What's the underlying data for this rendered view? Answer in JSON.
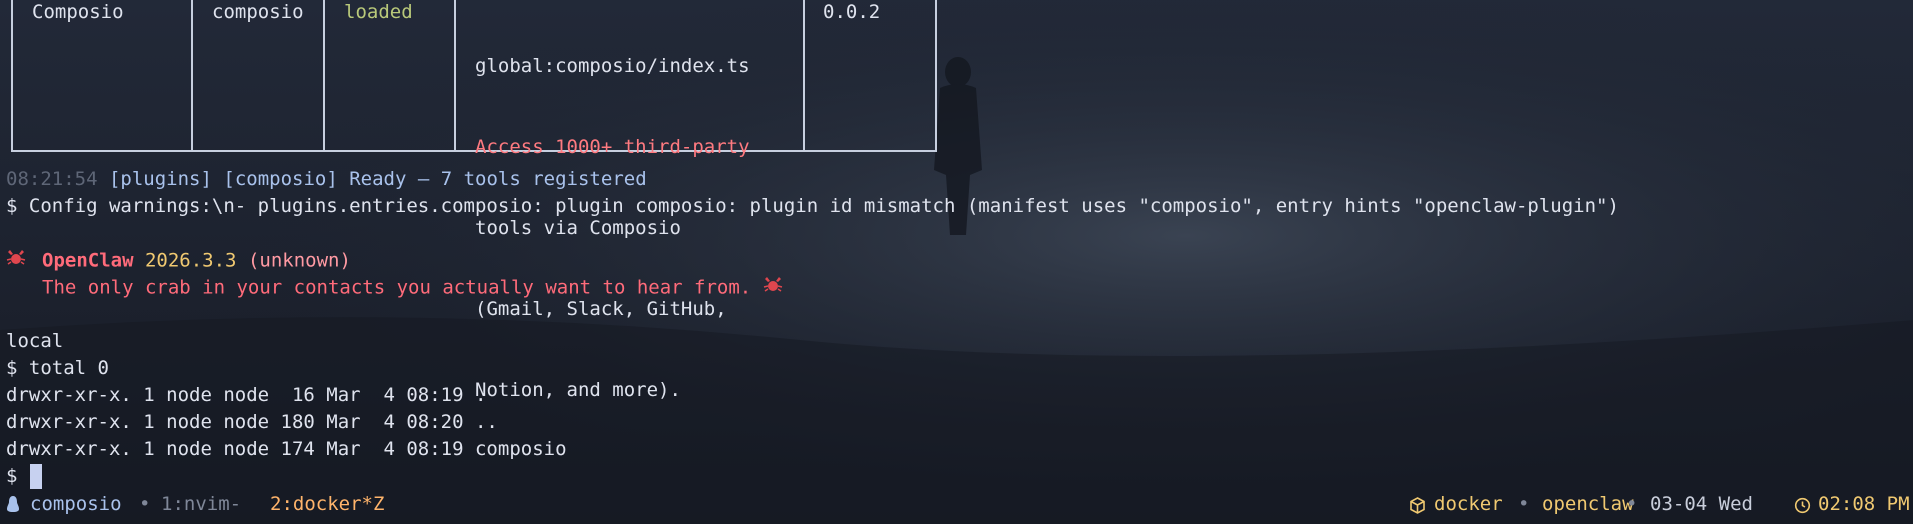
{
  "plugin_table": {
    "row": {
      "name": "Composio",
      "id": "composio",
      "status": "loaded",
      "source": "global:composio/index.ts",
      "description_highlight": "Access 1000+ third-party",
      "description_lines": [
        "tools via Composio",
        "(Gmail, Slack, GitHub,",
        "Notion, and more)."
      ],
      "version": "0.0.2"
    }
  },
  "log": {
    "timestamp": "08:21:54",
    "tag1": "[plugins]",
    "tag2": "[composio]",
    "message": "Ready — 7 tools registered"
  },
  "config_warning": "$ Config warnings:\\n- plugins.entries.composio: plugin composio: plugin id mismatch (manifest uses \"composio\", entry hints \"openclaw-plugin\")",
  "banner": {
    "app_name": "OpenClaw",
    "version": "2026.3.3",
    "build": "(unknown)",
    "tagline": "The only crab in your contacts you actually want to hear from."
  },
  "listing": {
    "header": "local",
    "total": "$ total 0",
    "entries": [
      "drwxr-xr-x. 1 node node  16 Mar  4 08:19 .",
      "drwxr-xr-x. 1 node node 180 Mar  4 08:20 ..",
      "drwxr-xr-x. 1 node node 174 Mar  4 08:19 composio"
    ],
    "prompt": "$"
  },
  "statusbar": {
    "session": "composio",
    "separator": "•",
    "window1": "1:nvim-",
    "window2": "2:docker*Z",
    "host": "docker",
    "container": "openclaw",
    "date": "03-04 Wed",
    "time": "02:08 PM",
    "icons": [
      "linux-icon",
      "box-icon",
      "clock-icon"
    ]
  },
  "colors": {
    "background": "#1d2330",
    "accent_red": "#ff6b7a",
    "accent_yellow": "#f0c971",
    "accent_blue": "#a9c2ec",
    "status_green": "#b9c97a"
  }
}
